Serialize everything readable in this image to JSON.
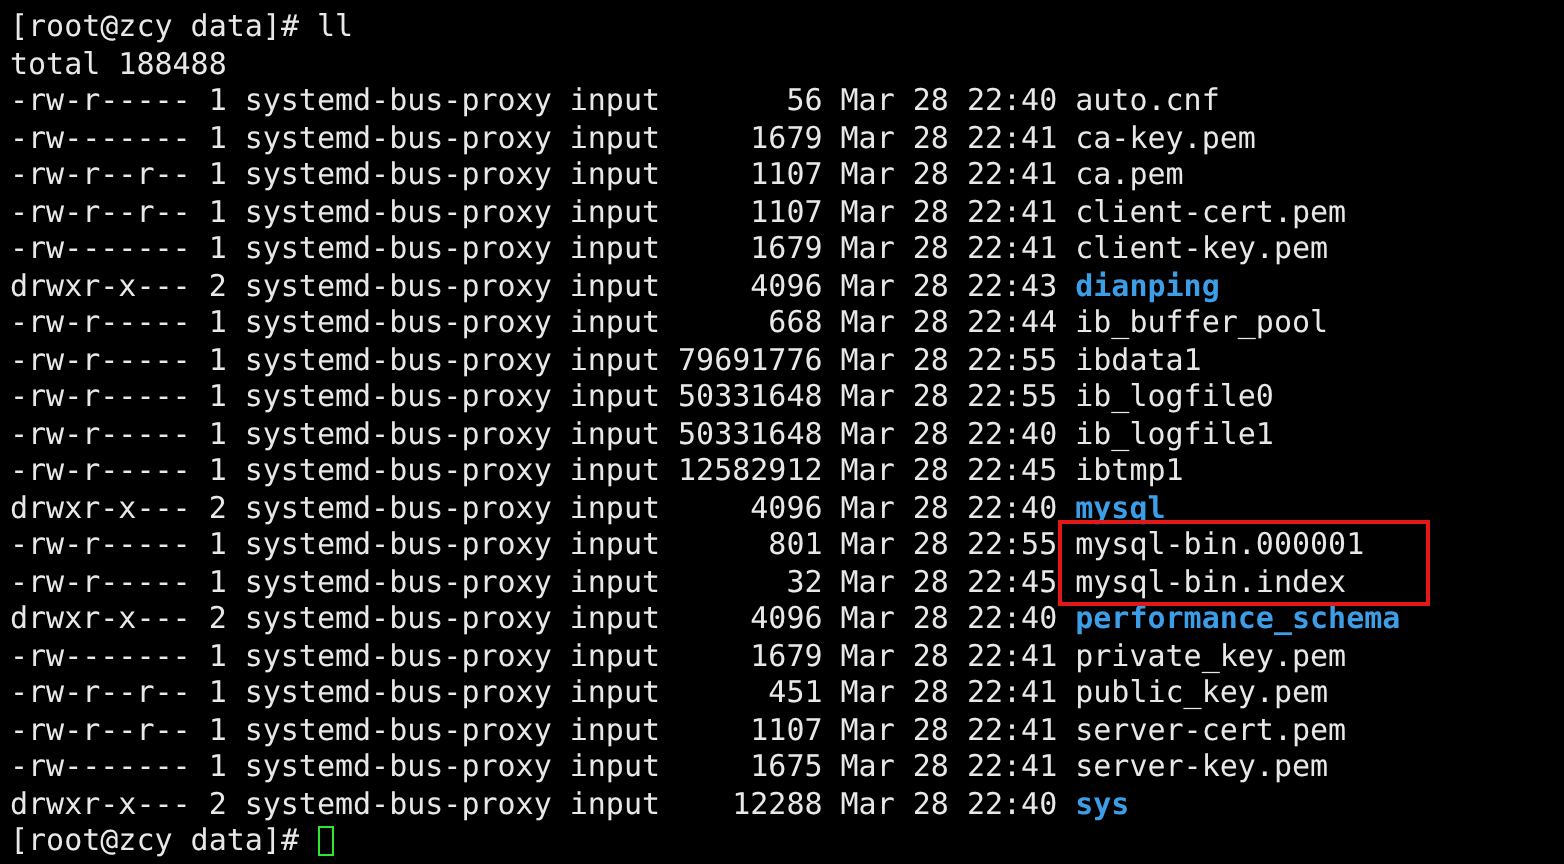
{
  "prompt": "[root@zcy data]# ll",
  "total": "total 188488",
  "entries": [
    {
      "perms": "-rw-r-----",
      "links": "1",
      "owner": "systemd-bus-proxy",
      "group": "input",
      "size": "56",
      "date": "Mar 28",
      "time": "22:40",
      "name": "auto.cnf",
      "kind": "file",
      "highlighted": false
    },
    {
      "perms": "-rw-------",
      "links": "1",
      "owner": "systemd-bus-proxy",
      "group": "input",
      "size": "1679",
      "date": "Mar 28",
      "time": "22:41",
      "name": "ca-key.pem",
      "kind": "file",
      "highlighted": false
    },
    {
      "perms": "-rw-r--r--",
      "links": "1",
      "owner": "systemd-bus-proxy",
      "group": "input",
      "size": "1107",
      "date": "Mar 28",
      "time": "22:41",
      "name": "ca.pem",
      "kind": "file",
      "highlighted": false
    },
    {
      "perms": "-rw-r--r--",
      "links": "1",
      "owner": "systemd-bus-proxy",
      "group": "input",
      "size": "1107",
      "date": "Mar 28",
      "time": "22:41",
      "name": "client-cert.pem",
      "kind": "file",
      "highlighted": false
    },
    {
      "perms": "-rw-------",
      "links": "1",
      "owner": "systemd-bus-proxy",
      "group": "input",
      "size": "1679",
      "date": "Mar 28",
      "time": "22:41",
      "name": "client-key.pem",
      "kind": "file",
      "highlighted": false
    },
    {
      "perms": "drwxr-x---",
      "links": "2",
      "owner": "systemd-bus-proxy",
      "group": "input",
      "size": "4096",
      "date": "Mar 28",
      "time": "22:43",
      "name": "dianping",
      "kind": "dir",
      "highlighted": false
    },
    {
      "perms": "-rw-r-----",
      "links": "1",
      "owner": "systemd-bus-proxy",
      "group": "input",
      "size": "668",
      "date": "Mar 28",
      "time": "22:44",
      "name": "ib_buffer_pool",
      "kind": "file",
      "highlighted": false
    },
    {
      "perms": "-rw-r-----",
      "links": "1",
      "owner": "systemd-bus-proxy",
      "group": "input",
      "size": "79691776",
      "date": "Mar 28",
      "time": "22:55",
      "name": "ibdata1",
      "kind": "file",
      "highlighted": false
    },
    {
      "perms": "-rw-r-----",
      "links": "1",
      "owner": "systemd-bus-proxy",
      "group": "input",
      "size": "50331648",
      "date": "Mar 28",
      "time": "22:55",
      "name": "ib_logfile0",
      "kind": "file",
      "highlighted": false
    },
    {
      "perms": "-rw-r-----",
      "links": "1",
      "owner": "systemd-bus-proxy",
      "group": "input",
      "size": "50331648",
      "date": "Mar 28",
      "time": "22:40",
      "name": "ib_logfile1",
      "kind": "file",
      "highlighted": false
    },
    {
      "perms": "-rw-r-----",
      "links": "1",
      "owner": "systemd-bus-proxy",
      "group": "input",
      "size": "12582912",
      "date": "Mar 28",
      "time": "22:45",
      "name": "ibtmp1",
      "kind": "file",
      "highlighted": false
    },
    {
      "perms": "drwxr-x---",
      "links": "2",
      "owner": "systemd-bus-proxy",
      "group": "input",
      "size": "4096",
      "date": "Mar 28",
      "time": "22:40",
      "name": "mysql",
      "kind": "dir",
      "highlighted": false
    },
    {
      "perms": "-rw-r-----",
      "links": "1",
      "owner": "systemd-bus-proxy",
      "group": "input",
      "size": "801",
      "date": "Mar 28",
      "time": "22:55",
      "name": "mysql-bin.000001",
      "kind": "file",
      "highlighted": true
    },
    {
      "perms": "-rw-r-----",
      "links": "1",
      "owner": "systemd-bus-proxy",
      "group": "input",
      "size": "32",
      "date": "Mar 28",
      "time": "22:45",
      "name": "mysql-bin.index",
      "kind": "file",
      "highlighted": true
    },
    {
      "perms": "drwxr-x---",
      "links": "2",
      "owner": "systemd-bus-proxy",
      "group": "input",
      "size": "4096",
      "date": "Mar 28",
      "time": "22:40",
      "name": "performance_schema",
      "kind": "dir",
      "highlighted": false
    },
    {
      "perms": "-rw-------",
      "links": "1",
      "owner": "systemd-bus-proxy",
      "group": "input",
      "size": "1679",
      "date": "Mar 28",
      "time": "22:41",
      "name": "private_key.pem",
      "kind": "file",
      "highlighted": false
    },
    {
      "perms": "-rw-r--r--",
      "links": "1",
      "owner": "systemd-bus-proxy",
      "group": "input",
      "size": "451",
      "date": "Mar 28",
      "time": "22:41",
      "name": "public_key.pem",
      "kind": "file",
      "highlighted": false
    },
    {
      "perms": "-rw-r--r--",
      "links": "1",
      "owner": "systemd-bus-proxy",
      "group": "input",
      "size": "1107",
      "date": "Mar 28",
      "time": "22:41",
      "name": "server-cert.pem",
      "kind": "file",
      "highlighted": false
    },
    {
      "perms": "-rw-------",
      "links": "1",
      "owner": "systemd-bus-proxy",
      "group": "input",
      "size": "1675",
      "date": "Mar 28",
      "time": "22:41",
      "name": "server-key.pem",
      "kind": "file",
      "highlighted": false
    },
    {
      "perms": "drwxr-x---",
      "links": "2",
      "owner": "systemd-bus-proxy",
      "group": "input",
      "size": "12288",
      "date": "Mar 28",
      "time": "22:40",
      "name": "sys",
      "kind": "dir",
      "highlighted": false
    }
  ],
  "final_prompt": "[root@zcy data]#"
}
